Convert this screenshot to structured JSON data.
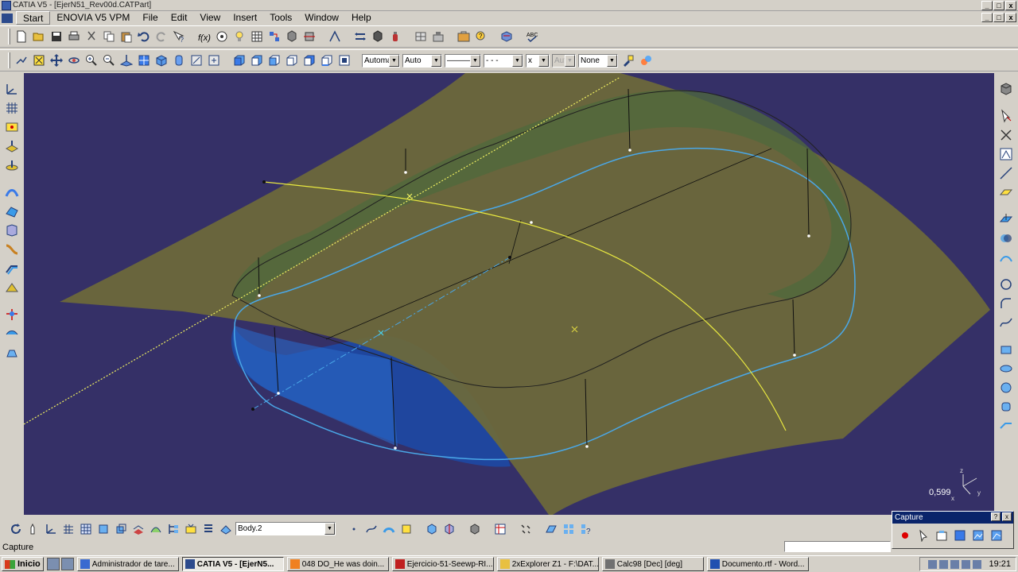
{
  "window": {
    "title": "CATIA V5 - [EjerN51_Rev00d.CATPart]",
    "controls": [
      "_",
      "□",
      "x"
    ],
    "doc_controls": [
      "_",
      "□",
      "x"
    ]
  },
  "menu": [
    "Start",
    "ENOVIA V5 VPM",
    "File",
    "Edit",
    "View",
    "Insert",
    "Tools",
    "Window",
    "Help"
  ],
  "toolbar2": {
    "color_combo": "Automa",
    "transparency_combo": "Auto",
    "line_thickness": "———",
    "line_type": "- - -",
    "point_type": "x",
    "layer_combo_disabled": "Aut",
    "layer_combo": "None"
  },
  "viewport": {
    "background": "#353067",
    "scale_readout": "0,599",
    "axis_labels": {
      "x": "x",
      "y": "y",
      "z": "z"
    }
  },
  "bottom_toolbar": {
    "body_combo": "Body.2"
  },
  "status": {
    "text": "Capture"
  },
  "capture_panel": {
    "title": "Capture",
    "buttons": [
      "?",
      "x"
    ]
  },
  "taskbar": {
    "start": "Inicio",
    "tasks": [
      {
        "label": "Administrador de tare...",
        "icon": "task-manager-icon",
        "active": false
      },
      {
        "label": "CATIA V5 - [EjerN5...",
        "icon": "catia-icon",
        "active": true
      },
      {
        "label": "048 DO_He was doin...",
        "icon": "vlc-icon",
        "active": false
      },
      {
        "label": "Ejercicio-51-Seewp-RI...",
        "icon": "pdf-icon",
        "active": false
      },
      {
        "label": "2xExplorer Z1 - F:\\DAT...",
        "icon": "folder-icon",
        "active": false
      },
      {
        "label": "Calc98 [Dec] [deg]",
        "icon": "calculator-icon",
        "active": false
      },
      {
        "label": "Documento.rtf - Word...",
        "icon": "word-icon",
        "active": false
      }
    ],
    "clock": "19:21"
  }
}
